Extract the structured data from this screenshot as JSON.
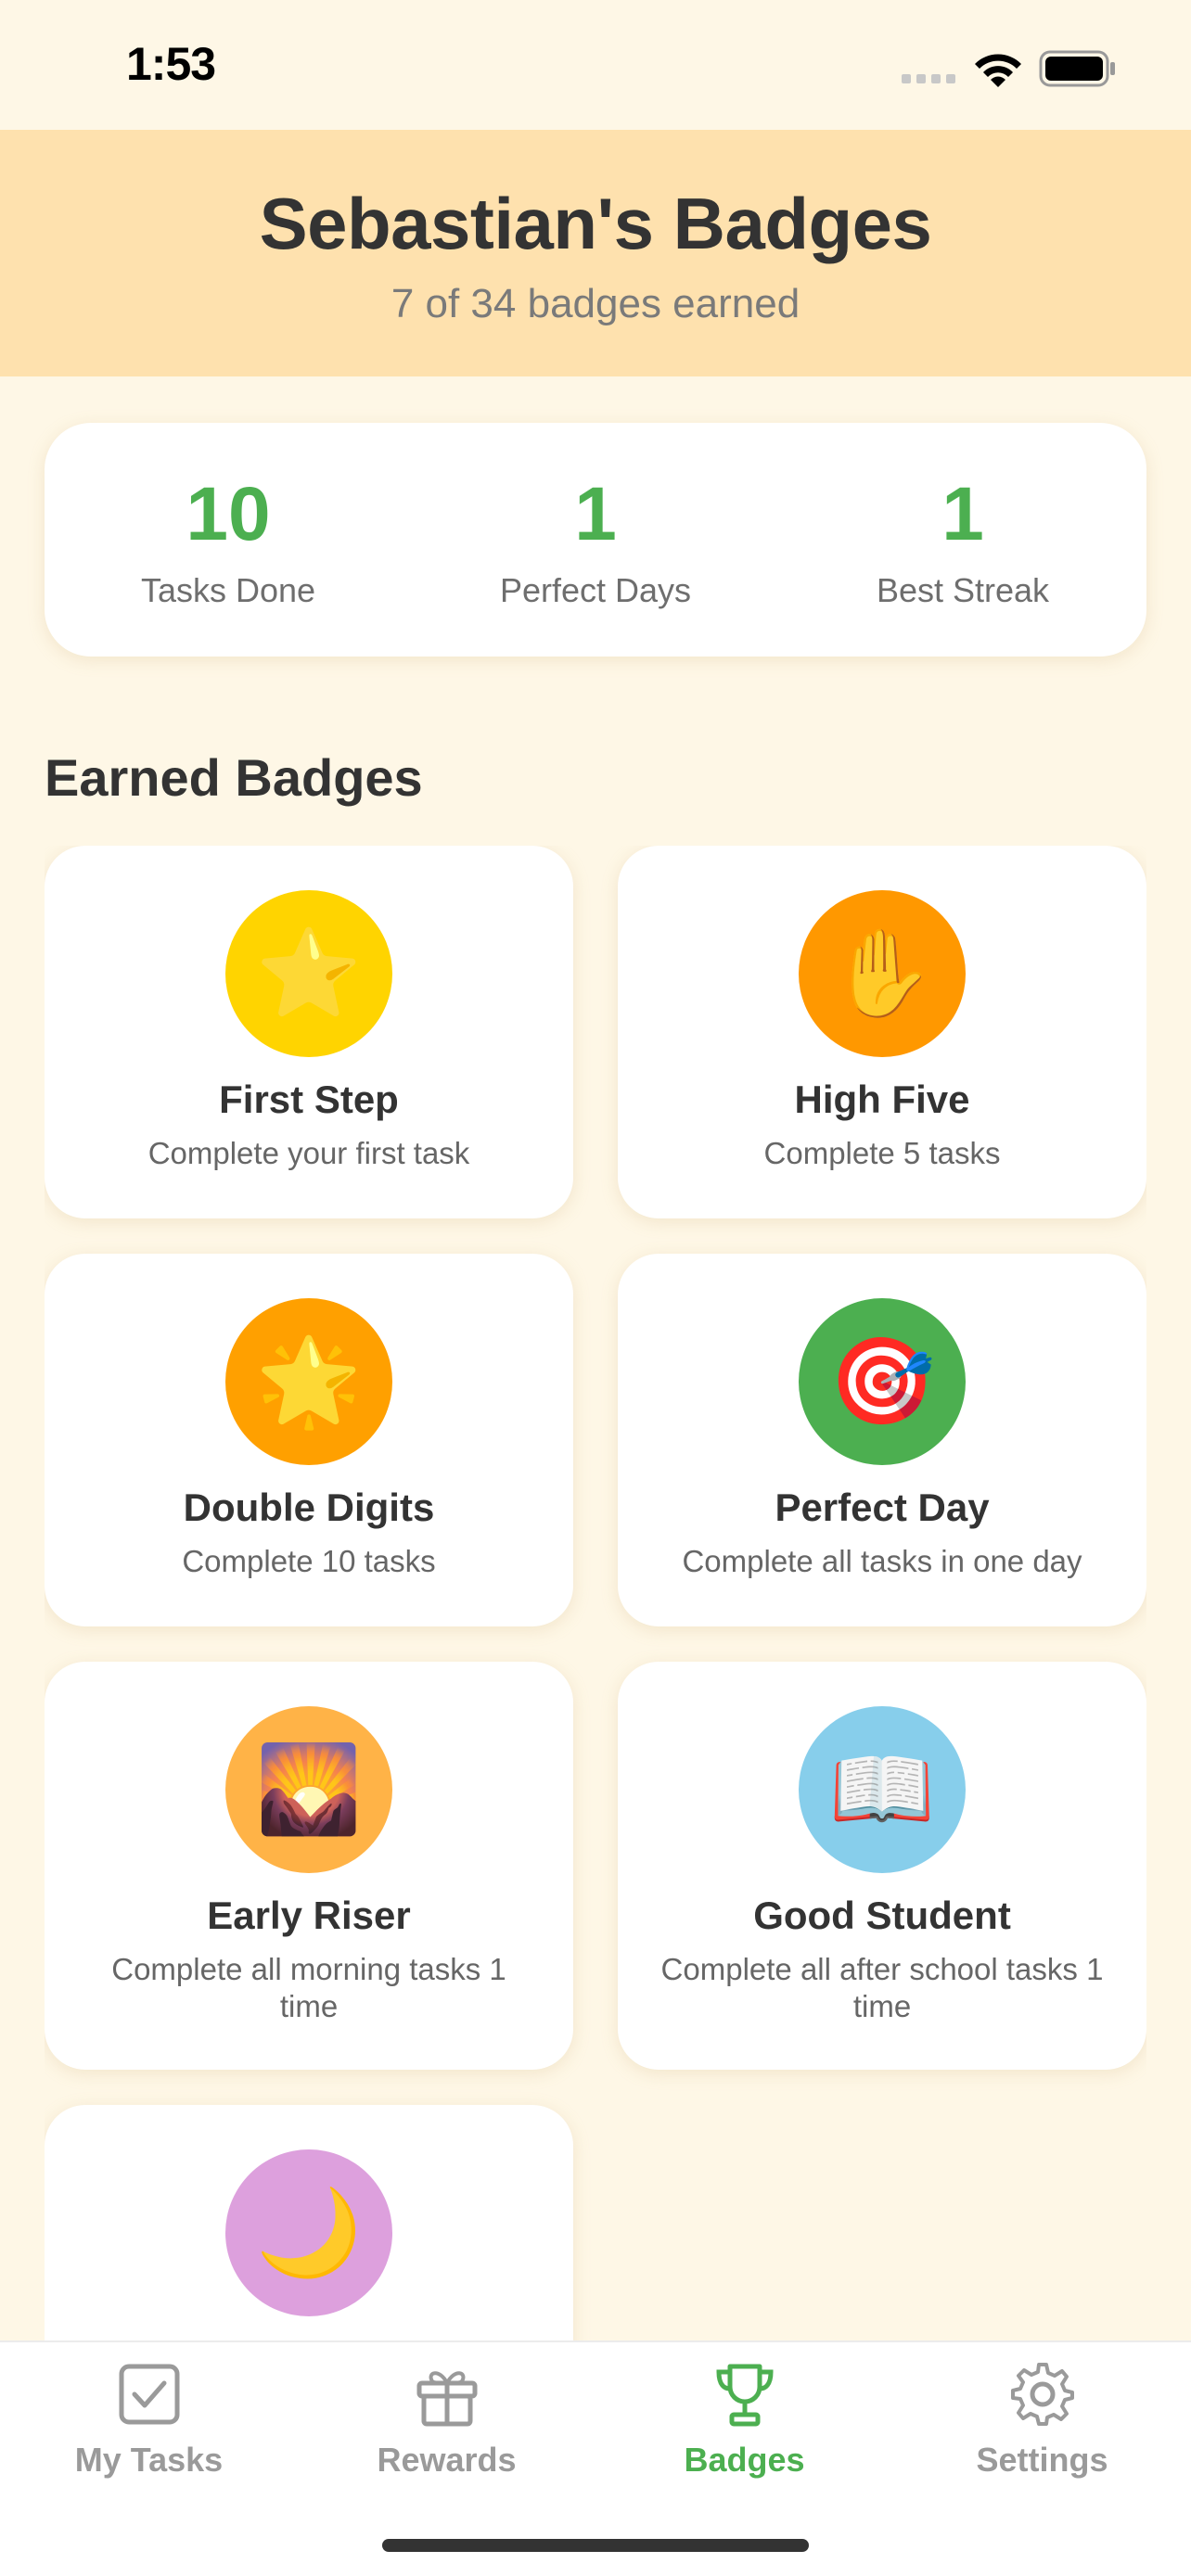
{
  "status": {
    "time": "1:53"
  },
  "header": {
    "title": "Sebastian's Badges",
    "subtitle": "7 of 34 badges earned"
  },
  "stats": [
    {
      "value": "10",
      "label": "Tasks Done"
    },
    {
      "value": "1",
      "label": "Perfect Days"
    },
    {
      "value": "1",
      "label": "Best Streak"
    }
  ],
  "section": {
    "title": "Earned Badges"
  },
  "badges": [
    {
      "icon": "star-icon",
      "glyph": "⭐",
      "color": "#FFD400",
      "name": "First Step",
      "desc": "Complete your first task"
    },
    {
      "icon": "raised-hand-icon",
      "glyph": "✋",
      "color": "#FF9800",
      "name": "High Five",
      "desc": "Complete 5 tasks"
    },
    {
      "icon": "glowing-star-icon",
      "glyph": "🌟",
      "color": "#FFA000",
      "name": "Double Digits",
      "desc": "Complete 10 tasks"
    },
    {
      "icon": "bullseye-icon",
      "glyph": "🎯",
      "color": "#4CAF50",
      "name": "Perfect Day",
      "desc": "Complete all tasks in one day"
    },
    {
      "icon": "sunrise-icon",
      "glyph": "🌄",
      "color": "#FFB347",
      "name": "Early Riser",
      "desc": "Complete all morning tasks 1 time"
    },
    {
      "icon": "open-book-icon",
      "glyph": "📖",
      "color": "#87CEEB",
      "name": "Good Student",
      "desc": "Complete all after school tasks 1 time"
    },
    {
      "icon": "crescent-moon-icon",
      "glyph": "🌙",
      "color": "#DDA0DD",
      "name": "",
      "desc": ""
    }
  ],
  "tabs": [
    {
      "label": "My Tasks",
      "icon": "checkbox-icon",
      "active": false
    },
    {
      "label": "Rewards",
      "icon": "gift-icon",
      "active": false
    },
    {
      "label": "Badges",
      "icon": "trophy-icon",
      "active": true
    },
    {
      "label": "Settings",
      "icon": "gear-icon",
      "active": false
    }
  ],
  "colors": {
    "accent": "#4CAF50",
    "background": "#FEF7E6",
    "header": "#FEE1AE"
  }
}
